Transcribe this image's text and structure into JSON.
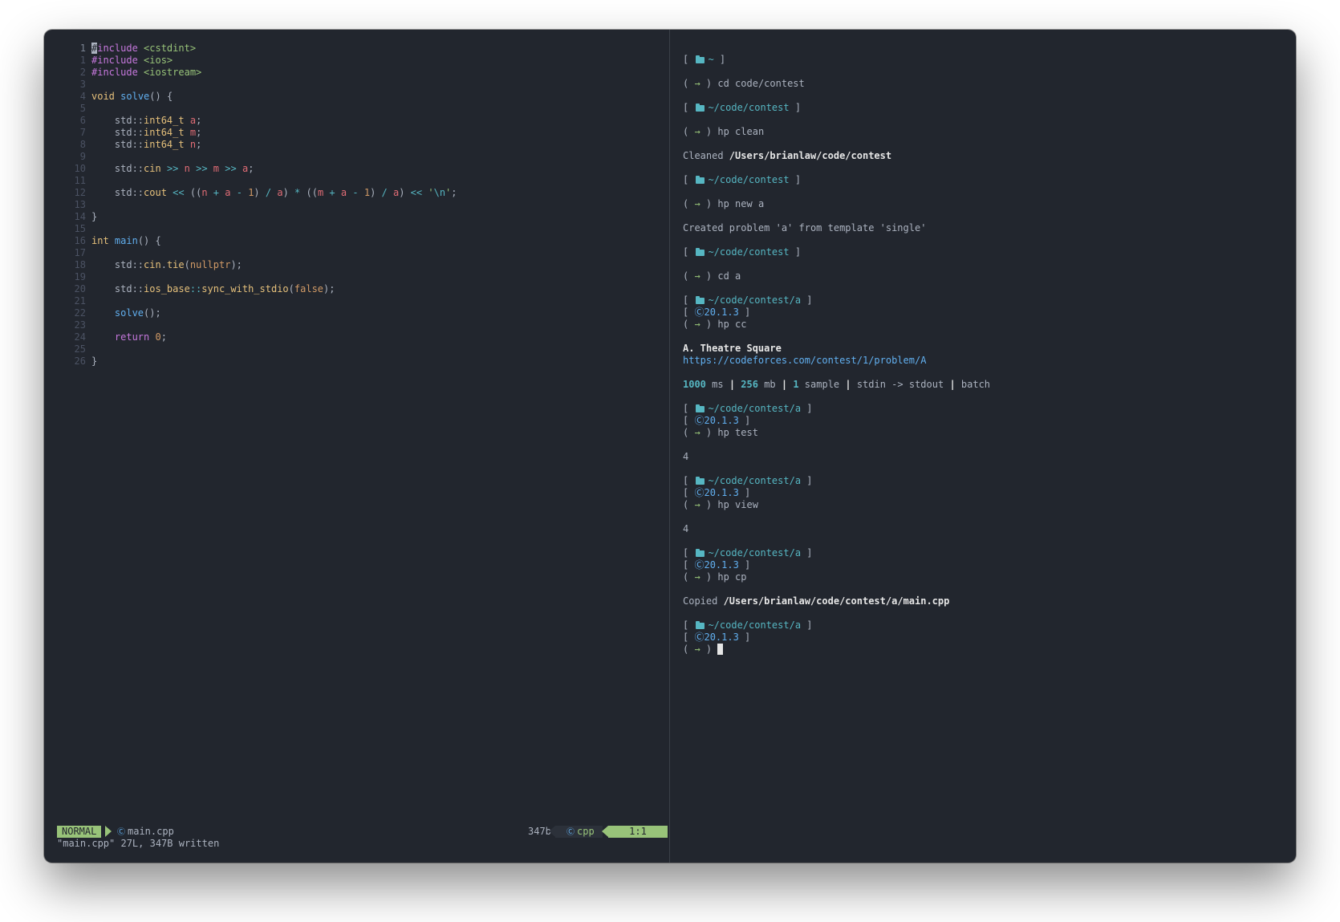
{
  "editor": {
    "lines": [
      {
        "n": "1",
        "tokens": [
          {
            "t": "#",
            "c": "cursor-block"
          },
          {
            "t": "include",
            "c": "kw"
          },
          {
            "t": " <cstdint>",
            "c": "str"
          }
        ]
      },
      {
        "n": "1",
        "tokens": [
          {
            "t": "#include",
            "c": "kw"
          },
          {
            "t": " <ios>",
            "c": "str"
          }
        ]
      },
      {
        "n": "2",
        "tokens": [
          {
            "t": "#include",
            "c": "kw"
          },
          {
            "t": " <iostream>",
            "c": "str"
          }
        ]
      },
      {
        "n": "3",
        "tokens": []
      },
      {
        "n": "4",
        "tokens": [
          {
            "t": "void",
            "c": "ty"
          },
          {
            "t": " "
          },
          {
            "t": "solve",
            "c": "fn"
          },
          {
            "t": "() {"
          }
        ]
      },
      {
        "n": "5",
        "tokens": []
      },
      {
        "n": "6",
        "tokens": [
          {
            "t": "    std::"
          },
          {
            "t": "int64_t",
            "c": "ty"
          },
          {
            "t": " "
          },
          {
            "t": "a",
            "c": "var"
          },
          {
            "t": ";"
          }
        ]
      },
      {
        "n": "7",
        "tokens": [
          {
            "t": "    std::"
          },
          {
            "t": "int64_t",
            "c": "ty"
          },
          {
            "t": " "
          },
          {
            "t": "m",
            "c": "var"
          },
          {
            "t": ";"
          }
        ]
      },
      {
        "n": "8",
        "tokens": [
          {
            "t": "    std::"
          },
          {
            "t": "int64_t",
            "c": "ty"
          },
          {
            "t": " "
          },
          {
            "t": "n",
            "c": "var"
          },
          {
            "t": ";"
          }
        ]
      },
      {
        "n": "9",
        "tokens": []
      },
      {
        "n": "10",
        "tokens": [
          {
            "t": "    std::"
          },
          {
            "t": "cin",
            "c": "ty"
          },
          {
            "t": " "
          },
          {
            "t": ">>",
            "c": "op"
          },
          {
            "t": " "
          },
          {
            "t": "n",
            "c": "var"
          },
          {
            "t": " "
          },
          {
            "t": ">>",
            "c": "op"
          },
          {
            "t": " "
          },
          {
            "t": "m",
            "c": "var"
          },
          {
            "t": " "
          },
          {
            "t": ">>",
            "c": "op"
          },
          {
            "t": " "
          },
          {
            "t": "a",
            "c": "var"
          },
          {
            "t": ";"
          }
        ]
      },
      {
        "n": "11",
        "tokens": []
      },
      {
        "n": "12",
        "tokens": [
          {
            "t": "    std::"
          },
          {
            "t": "cout",
            "c": "ty"
          },
          {
            "t": " "
          },
          {
            "t": "<<",
            "c": "op"
          },
          {
            "t": " (("
          },
          {
            "t": "n",
            "c": "var"
          },
          {
            "t": " "
          },
          {
            "t": "+",
            "c": "op"
          },
          {
            "t": " "
          },
          {
            "t": "a",
            "c": "var"
          },
          {
            "t": " "
          },
          {
            "t": "-",
            "c": "op"
          },
          {
            "t": " "
          },
          {
            "t": "1",
            "c": "num"
          },
          {
            "t": ") "
          },
          {
            "t": "/",
            "c": "op"
          },
          {
            "t": " "
          },
          {
            "t": "a",
            "c": "var"
          },
          {
            "t": ") "
          },
          {
            "t": "*",
            "c": "op"
          },
          {
            "t": " (("
          },
          {
            "t": "m",
            "c": "var"
          },
          {
            "t": " "
          },
          {
            "t": "+",
            "c": "op"
          },
          {
            "t": " "
          },
          {
            "t": "a",
            "c": "var"
          },
          {
            "t": " "
          },
          {
            "t": "-",
            "c": "op"
          },
          {
            "t": " "
          },
          {
            "t": "1",
            "c": "num"
          },
          {
            "t": ") "
          },
          {
            "t": "/",
            "c": "op"
          },
          {
            "t": " "
          },
          {
            "t": "a",
            "c": "var"
          },
          {
            "t": ") "
          },
          {
            "t": "<<",
            "c": "op"
          },
          {
            "t": " "
          },
          {
            "t": "'",
            "c": "str"
          },
          {
            "t": "\\n",
            "c": "esc"
          },
          {
            "t": "'",
            "c": "str"
          },
          {
            "t": ";"
          }
        ]
      },
      {
        "n": "13",
        "tokens": []
      },
      {
        "n": "14",
        "tokens": [
          {
            "t": "}"
          }
        ]
      },
      {
        "n": "15",
        "tokens": []
      },
      {
        "n": "16",
        "tokens": [
          {
            "t": "int",
            "c": "ty"
          },
          {
            "t": " "
          },
          {
            "t": "main",
            "c": "fn"
          },
          {
            "t": "() {"
          }
        ]
      },
      {
        "n": "17",
        "tokens": []
      },
      {
        "n": "18",
        "tokens": [
          {
            "t": "    std::"
          },
          {
            "t": "cin",
            "c": "ty"
          },
          {
            "t": "."
          },
          {
            "t": "tie",
            "c": "ty"
          },
          {
            "t": "("
          },
          {
            "t": "nullptr",
            "c": "num"
          },
          {
            "t": ");"
          }
        ]
      },
      {
        "n": "19",
        "tokens": []
      },
      {
        "n": "20",
        "tokens": [
          {
            "t": "    std::"
          },
          {
            "t": "ios_base",
            "c": "ty"
          },
          {
            "t": "::",
            "c": "op"
          },
          {
            "t": "sync_with_stdio",
            "c": "ty"
          },
          {
            "t": "("
          },
          {
            "t": "false",
            "c": "num"
          },
          {
            "t": ");"
          }
        ]
      },
      {
        "n": "21",
        "tokens": []
      },
      {
        "n": "22",
        "tokens": [
          {
            "t": "    "
          },
          {
            "t": "solve",
            "c": "fn"
          },
          {
            "t": "();"
          }
        ]
      },
      {
        "n": "23",
        "tokens": []
      },
      {
        "n": "24",
        "tokens": [
          {
            "t": "    "
          },
          {
            "t": "return",
            "c": "kw"
          },
          {
            "t": " "
          },
          {
            "t": "0",
            "c": "num"
          },
          {
            "t": ";"
          }
        ]
      },
      {
        "n": "25",
        "tokens": []
      },
      {
        "n": "26",
        "tokens": [
          {
            "t": "}"
          }
        ]
      }
    ],
    "statusline": {
      "mode": "NORMAL",
      "filename": "main.cpp",
      "filesize": "347b",
      "filetype": "cpp",
      "position": "1:1"
    },
    "cmdline": "\"main.cpp\" 27L, 347B written"
  },
  "terminal": {
    "lines": [
      {
        "k": "dir",
        "path": "~"
      },
      {
        "k": "gap"
      },
      {
        "k": "prompt",
        "cmd": "cd code/contest"
      },
      {
        "k": "gap"
      },
      {
        "k": "dir",
        "path": "~/code/contest"
      },
      {
        "k": "gap"
      },
      {
        "k": "prompt",
        "cmd": "hp clean"
      },
      {
        "k": "gap"
      },
      {
        "k": "out",
        "parts": [
          {
            "t": "Cleaned "
          },
          {
            "t": "/Users/brianlaw/code/contest",
            "c": "bold"
          }
        ]
      },
      {
        "k": "gap"
      },
      {
        "k": "dir",
        "path": "~/code/contest"
      },
      {
        "k": "gap"
      },
      {
        "k": "prompt",
        "cmd": "hp new a"
      },
      {
        "k": "gap"
      },
      {
        "k": "out",
        "parts": [
          {
            "t": "Created problem 'a' from template 'single'"
          }
        ]
      },
      {
        "k": "gap"
      },
      {
        "k": "dir",
        "path": "~/code/contest"
      },
      {
        "k": "gap"
      },
      {
        "k": "prompt",
        "cmd": "cd a"
      },
      {
        "k": "gap"
      },
      {
        "k": "dir",
        "path": "~/code/contest/a"
      },
      {
        "k": "ver",
        "ver": "20.1.3"
      },
      {
        "k": "prompt",
        "cmd": "hp cc"
      },
      {
        "k": "gap"
      },
      {
        "k": "out",
        "parts": [
          {
            "t": "A. Theatre Square",
            "c": "bold"
          }
        ]
      },
      {
        "k": "out",
        "parts": [
          {
            "t": "https://codeforces.com/contest/1/problem/A",
            "c": "link"
          }
        ]
      },
      {
        "k": "gap"
      },
      {
        "k": "out",
        "parts": [
          {
            "t": "1000",
            "c": "hl"
          },
          {
            "t": " ms "
          },
          {
            "t": "|",
            "c": "bold"
          },
          {
            "t": " "
          },
          {
            "t": "256",
            "c": "hl"
          },
          {
            "t": " mb "
          },
          {
            "t": "|",
            "c": "bold"
          },
          {
            "t": " "
          },
          {
            "t": "1",
            "c": "hl"
          },
          {
            "t": " sample "
          },
          {
            "t": "|",
            "c": "bold"
          },
          {
            "t": " stdin -> stdout "
          },
          {
            "t": "|",
            "c": "bold"
          },
          {
            "t": " batch"
          }
        ]
      },
      {
        "k": "gap"
      },
      {
        "k": "dir",
        "path": "~/code/contest/a"
      },
      {
        "k": "ver",
        "ver": "20.1.3"
      },
      {
        "k": "prompt",
        "cmd": "hp test"
      },
      {
        "k": "gap"
      },
      {
        "k": "out",
        "parts": [
          {
            "t": "4"
          }
        ]
      },
      {
        "k": "gap"
      },
      {
        "k": "dir",
        "path": "~/code/contest/a"
      },
      {
        "k": "ver",
        "ver": "20.1.3"
      },
      {
        "k": "prompt",
        "cmd": "hp view"
      },
      {
        "k": "gap"
      },
      {
        "k": "out",
        "parts": [
          {
            "t": "4"
          }
        ]
      },
      {
        "k": "gap"
      },
      {
        "k": "dir",
        "path": "~/code/contest/a"
      },
      {
        "k": "ver",
        "ver": "20.1.3"
      },
      {
        "k": "prompt",
        "cmd": "hp cp"
      },
      {
        "k": "gap"
      },
      {
        "k": "out",
        "parts": [
          {
            "t": "Copied "
          },
          {
            "t": "/Users/brianlaw/code/contest/a/main.cpp",
            "c": "bold"
          }
        ]
      },
      {
        "k": "gap"
      },
      {
        "k": "dir",
        "path": "~/code/contest/a"
      },
      {
        "k": "ver",
        "ver": "20.1.3"
      },
      {
        "k": "prompt",
        "cmd": "",
        "cursor": true
      }
    ]
  },
  "icons": {
    "folder": "folder-icon",
    "prompt_arrow": "arrow-right-icon",
    "language": "c-language-icon"
  },
  "colors": {
    "background": "#22262e",
    "mode_green": "#98c379",
    "path_cyan": "#56b6c2",
    "version_blue": "#61afef"
  }
}
